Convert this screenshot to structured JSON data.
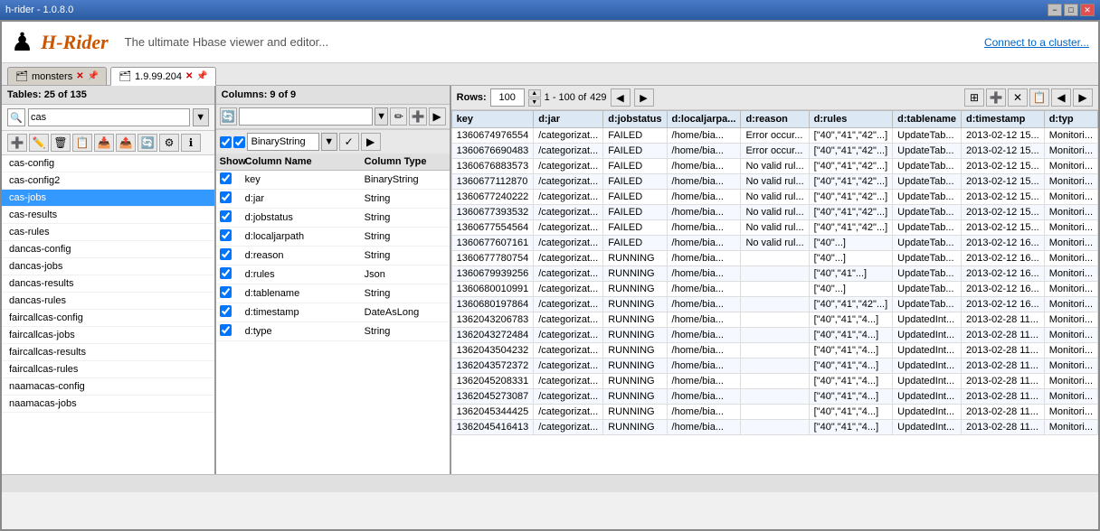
{
  "titleBar": {
    "title": "h-rider - 1.0.8.0",
    "minBtn": "−",
    "maxBtn": "□",
    "closeBtn": "✕"
  },
  "header": {
    "logoIcon": "♟",
    "logoTitle": "H-Rider",
    "subtitle": "The ultimate Hbase viewer and editor...",
    "connectLink": "Connect to a cluster..."
  },
  "tabs": [
    {
      "id": "monsters",
      "label": "monsters",
      "active": false
    },
    {
      "id": "1.9.99.204",
      "label": "1.9.99.204",
      "active": true
    }
  ],
  "leftPanel": {
    "header": "Tables:  25 of 135",
    "searchPlaceholder": "cas",
    "searchValue": "cas",
    "tables": [
      "cas-config",
      "cas-config2",
      "cas-jobs",
      "cas-results",
      "cas-rules",
      "dancas-config",
      "dancas-jobs",
      "dancas-results",
      "dancas-rules",
      "faircallcas-config",
      "faircallcas-jobs",
      "faircallcas-results",
      "faircallcas-rules",
      "naamacas-config",
      "naamacas-jobs"
    ],
    "selectedTable": "cas-jobs"
  },
  "midPanel": {
    "header": "Columns:  9 of 9",
    "columns": [
      {
        "checked": true,
        "name": "key",
        "type": "BinaryString"
      },
      {
        "checked": true,
        "name": "d:jar",
        "type": "String"
      },
      {
        "checked": true,
        "name": "d:jobstatus",
        "type": "String"
      },
      {
        "checked": true,
        "name": "d:localjarpath",
        "type": "String"
      },
      {
        "checked": true,
        "name": "d:reason",
        "type": "String"
      },
      {
        "checked": true,
        "name": "d:rules",
        "type": "Json"
      },
      {
        "checked": true,
        "name": "d:tablename",
        "type": "String"
      },
      {
        "checked": true,
        "name": "d:timestamp",
        "type": "DateAsLong"
      },
      {
        "checked": true,
        "name": "d:type",
        "type": "String"
      }
    ],
    "typeLabel": "BinaryString"
  },
  "dataGrid": {
    "rowsLabel": "Rows:",
    "pageSize": "100",
    "rangeStart": "1",
    "rangeDash": "-",
    "rangeEnd": "100",
    "ofLabel": "of",
    "total": "429",
    "columns": [
      "key",
      "d:jar",
      "d:jobstatus",
      "d:localjarpa...",
      "d:reason",
      "d:rules",
      "d:tablename",
      "d:timestamp",
      "d:typ"
    ],
    "rows": [
      [
        "1360674976554",
        "/categorizat...",
        "FAILED",
        "/home/bia...",
        "Error occur...",
        "[\"40\",\"41\",\"42\"...]",
        "UpdateTab...",
        "2013-02-12 15...",
        "Monitori..."
      ],
      [
        "1360676690483",
        "/categorizat...",
        "FAILED",
        "/home/bia...",
        "Error occur...",
        "[\"40\",\"41\",\"42\"...]",
        "UpdateTab...",
        "2013-02-12 15...",
        "Monitori..."
      ],
      [
        "1360676883573",
        "/categorizat...",
        "FAILED",
        "/home/bia...",
        "No valid rul...",
        "[\"40\",\"41\",\"42\"...]",
        "UpdateTab...",
        "2013-02-12 15...",
        "Monitori..."
      ],
      [
        "1360677112870",
        "/categorizat...",
        "FAILED",
        "/home/bia...",
        "No valid rul...",
        "[\"40\",\"41\",\"42\"...]",
        "UpdateTab...",
        "2013-02-12 15...",
        "Monitori..."
      ],
      [
        "1360677240222",
        "/categorizat...",
        "FAILED",
        "/home/bia...",
        "No valid rul...",
        "[\"40\",\"41\",\"42\"...]",
        "UpdateTab...",
        "2013-02-12 15...",
        "Monitori..."
      ],
      [
        "1360677393532",
        "/categorizat...",
        "FAILED",
        "/home/bia...",
        "No valid rul...",
        "[\"40\",\"41\",\"42\"...]",
        "UpdateTab...",
        "2013-02-12 15...",
        "Monitori..."
      ],
      [
        "1360677554564",
        "/categorizat...",
        "FAILED",
        "/home/bia...",
        "No valid rul...",
        "[\"40\",\"41\",\"42\"...]",
        "UpdateTab...",
        "2013-02-12 15...",
        "Monitori..."
      ],
      [
        "1360677607161",
        "/categorizat...",
        "FAILED",
        "/home/bia...",
        "No valid rul...",
        "[\"40\"...]",
        "UpdateTab...",
        "2013-02-12 16...",
        "Monitori..."
      ],
      [
        "1360677780754",
        "/categorizat...",
        "RUNNING",
        "/home/bia...",
        "",
        "[\"40\"...]",
        "UpdateTab...",
        "2013-02-12 16...",
        "Monitori..."
      ],
      [
        "1360679939256",
        "/categorizat...",
        "RUNNING",
        "/home/bia...",
        "",
        "[\"40\",\"41\"...]",
        "UpdateTab...",
        "2013-02-12 16...",
        "Monitori..."
      ],
      [
        "1360680010991",
        "/categorizat...",
        "RUNNING",
        "/home/bia...",
        "",
        "[\"40\"...]",
        "UpdateTab...",
        "2013-02-12 16...",
        "Monitori..."
      ],
      [
        "1360680197864",
        "/categorizat...",
        "RUNNING",
        "/home/bia...",
        "",
        "[\"40\",\"41\",\"42\"...]",
        "UpdateTab...",
        "2013-02-12 16...",
        "Monitori..."
      ],
      [
        "1362043206783",
        "/categorizat...",
        "RUNNING",
        "/home/bia...",
        "",
        "[\"40\",\"41\",\"4...]",
        "UpdatedInt...",
        "2013-02-28 11...",
        "Monitori..."
      ],
      [
        "1362043272484",
        "/categorizat...",
        "RUNNING",
        "/home/bia...",
        "",
        "[\"40\",\"41\",\"4...]",
        "UpdatedInt...",
        "2013-02-28 11...",
        "Monitori..."
      ],
      [
        "1362043504232",
        "/categorizat...",
        "RUNNING",
        "/home/bia...",
        "",
        "[\"40\",\"41\",\"4...]",
        "UpdatedInt...",
        "2013-02-28 11...",
        "Monitori..."
      ],
      [
        "1362043572372",
        "/categorizat...",
        "RUNNING",
        "/home/bia...",
        "",
        "[\"40\",\"41\",\"4...]",
        "UpdatedInt...",
        "2013-02-28 11...",
        "Monitori..."
      ],
      [
        "1362045208331",
        "/categorizat...",
        "RUNNING",
        "/home/bia...",
        "",
        "[\"40\",\"41\",\"4...]",
        "UpdatedInt...",
        "2013-02-28 11...",
        "Monitori..."
      ],
      [
        "1362045273087",
        "/categorizat...",
        "RUNNING",
        "/home/bia...",
        "",
        "[\"40\",\"41\",\"4...]",
        "UpdatedInt...",
        "2013-02-28 11...",
        "Monitori..."
      ],
      [
        "1362045344425",
        "/categorizat...",
        "RUNNING",
        "/home/bia...",
        "",
        "[\"40\",\"41\",\"4...]",
        "UpdatedInt...",
        "2013-02-28 11...",
        "Monitori..."
      ],
      [
        "1362045416413",
        "/categorizat...",
        "RUNNING",
        "/home/bia...",
        "",
        "[\"40\",\"41\",\"4...]",
        "UpdatedInt...",
        "2013-02-28 11...",
        "Monitori..."
      ]
    ]
  },
  "statusBar": {
    "text": ""
  }
}
